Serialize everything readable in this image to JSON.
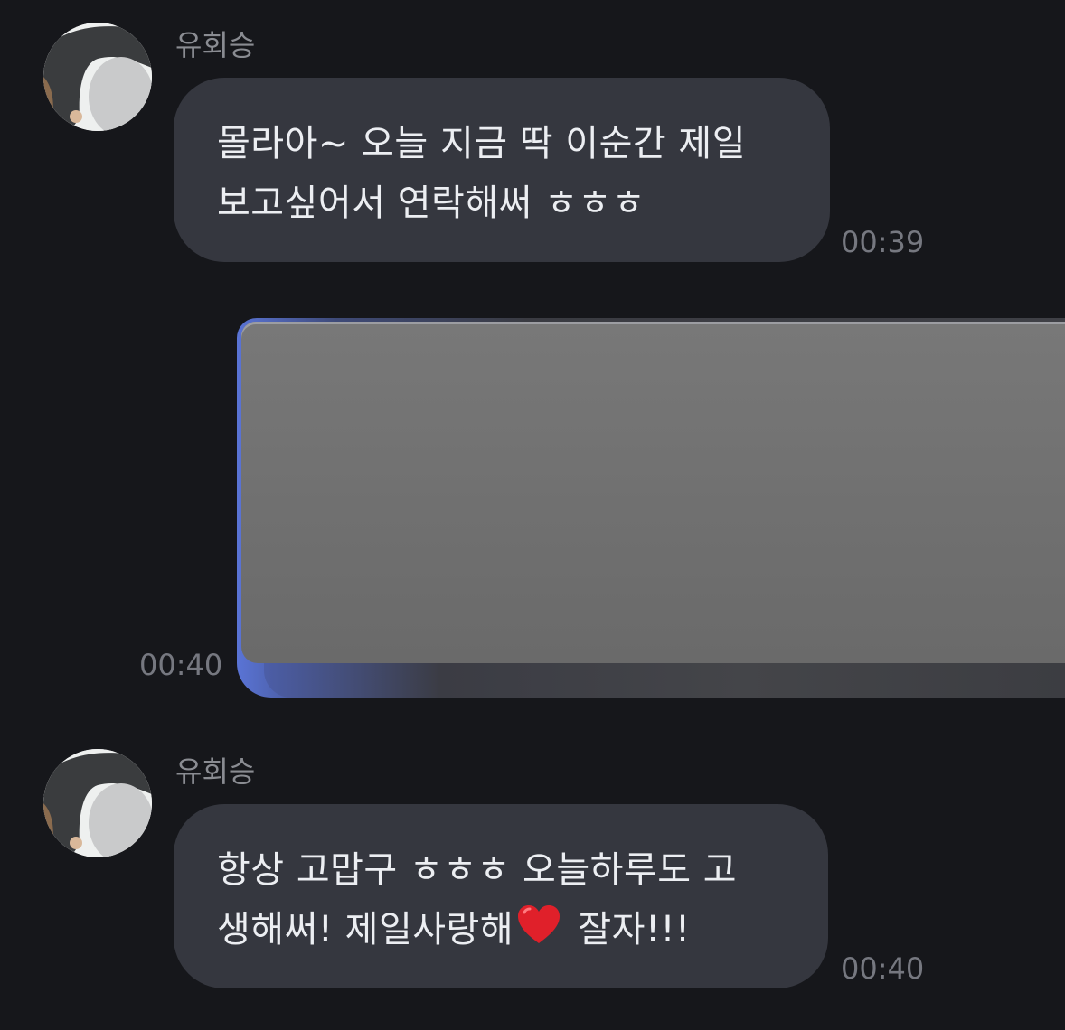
{
  "messages": [
    {
      "sender": "유회승",
      "lines": [
        "몰라아~ 오늘 지금 딱 이순간 제일",
        "보고싶어서 연락해써 ㅎㅎㅎ"
      ],
      "time": "00:39"
    },
    {
      "media_time": "00:40"
    },
    {
      "sender": "유회승",
      "line1": "항상 고맙구 ㅎㅎㅎ 오늘하루도 고",
      "line2_before": "생해써! 제일사랑해",
      "line2_after": " 잘자!!!",
      "time": "00:40"
    }
  ],
  "icons": {
    "heart": "red-heart-emoji",
    "avatar": "profile-photo"
  },
  "colors": {
    "background": "#16171b",
    "bubble": "#35373f",
    "text": "#eceef2",
    "meta": "#767880",
    "heart": "#e0202a"
  }
}
